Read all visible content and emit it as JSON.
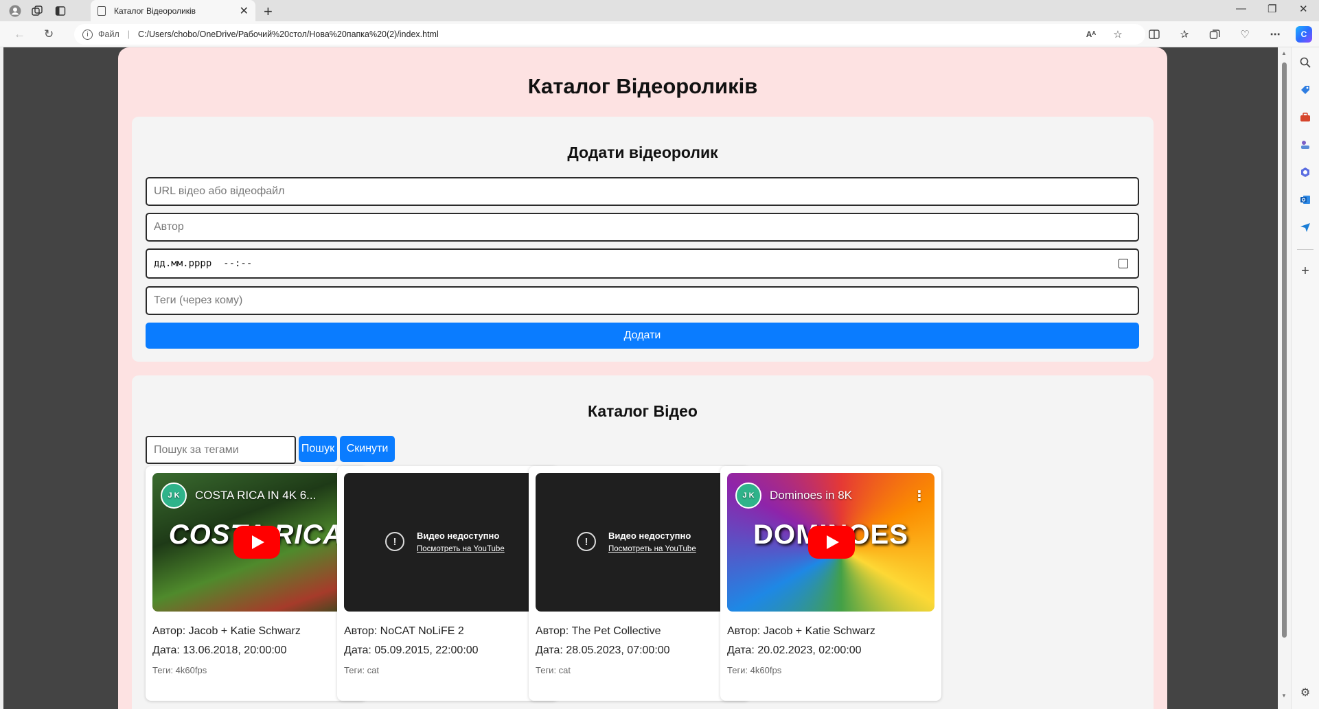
{
  "browser": {
    "tab_title": "Каталог Відеороликів",
    "address_scheme": "Файл",
    "address_url": "C:/Users/chobo/OneDrive/Рабочий%20стол/Нова%20папка%20(2)/index.html"
  },
  "page": {
    "title": "Каталог Відеороликів"
  },
  "add_form": {
    "heading": "Додати відеоролик",
    "url_placeholder": "URL відео або відеофайл",
    "author_placeholder": "Автор",
    "date_value": "дд.мм.рррр  --:--",
    "tags_placeholder": "Теги (через кому)",
    "submit_label": "Додати"
  },
  "catalog": {
    "heading": "Каталог Відео",
    "search_placeholder": "Пошук за тегами",
    "search_label": "Пошук",
    "reset_label": "Скинути",
    "videos": [
      {
        "state": "preview",
        "channel_logo": "J K",
        "video_title": "COSTA RICA IN 4K 6...",
        "thumb_word": "COSTA RICA",
        "author": "Автор: Jacob + Katie Schwarz",
        "date": "Дата: 13.06.2018, 20:00:00",
        "tags": "Теги: 4k60fps"
      },
      {
        "state": "unavailable",
        "unavailable_title": "Видео недоступно",
        "unavailable_link": "Посмотреть на YouTube",
        "author": "Автор: NoCAT NoLiFE 2",
        "date": "Дата: 05.09.2015, 22:00:00",
        "tags": "Теги: cat"
      },
      {
        "state": "unavailable",
        "unavailable_title": "Видео недоступно",
        "unavailable_link": "Посмотреть на YouTube",
        "author": "Автор: The Pet Collective",
        "date": "Дата: 28.05.2023, 07:00:00",
        "tags": "Теги: cat"
      },
      {
        "state": "preview",
        "channel_logo": "J K",
        "video_title": "Dominoes in 8K",
        "thumb_word": "DOMINOES",
        "author": "Автор: Jacob + Katie Schwarz",
        "date": "Дата: 20.02.2023, 02:00:00",
        "tags": "Теги: 4k60fps"
      }
    ]
  },
  "colors": {
    "page_bg": "#fde2e2",
    "panel_bg": "#f4f4f4",
    "primary_button": "#0a7cff",
    "youtube_red": "#ff0000"
  }
}
